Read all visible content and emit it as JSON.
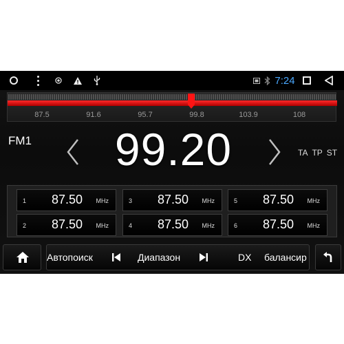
{
  "status_bar": {
    "time": "7:24",
    "icons": [
      "circle-home-icon",
      "vertical-dots-icon",
      "gps-icon",
      "warning-icon",
      "usb-icon",
      "sim-icon",
      "bluetooth-icon",
      "recents-square-icon",
      "back-triangle-icon"
    ]
  },
  "tuner": {
    "scale_labels": [
      "87.5",
      "91.6",
      "95.7",
      "99.8",
      "103.9",
      "108"
    ],
    "band": "FM1",
    "frequency": "99.20",
    "flags": [
      "TA",
      "TP",
      "ST"
    ]
  },
  "presets": [
    {
      "num": "1",
      "freq": "87.50",
      "unit": "MHz"
    },
    {
      "num": "3",
      "freq": "87.50",
      "unit": "MHz"
    },
    {
      "num": "5",
      "freq": "87.50",
      "unit": "MHz"
    },
    {
      "num": "2",
      "freq": "87.50",
      "unit": "MHz"
    },
    {
      "num": "4",
      "freq": "87.50",
      "unit": "MHz"
    },
    {
      "num": "6",
      "freq": "87.50",
      "unit": "MHz"
    }
  ],
  "controls": {
    "autosearch": "Автопоиск",
    "range": "Диапазон",
    "dx": "DX",
    "balance": "балансир"
  },
  "colors": {
    "accent_red": "#e01010",
    "clock_blue": "#4aa8ff"
  }
}
